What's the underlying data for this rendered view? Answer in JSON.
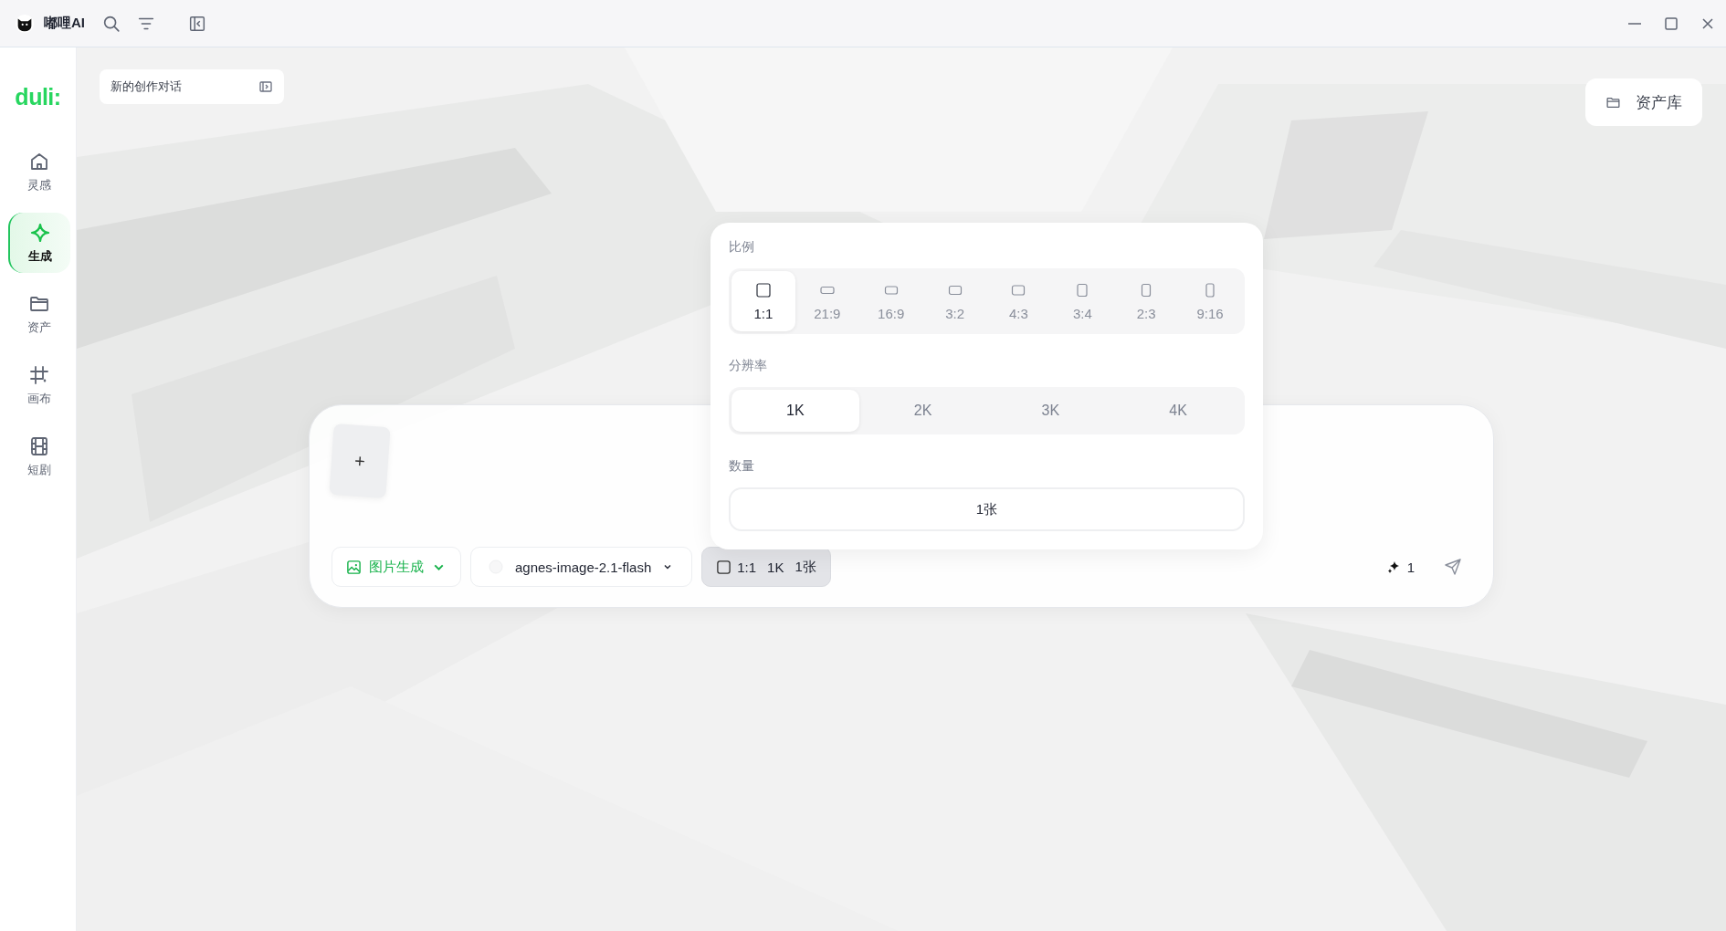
{
  "app": {
    "title": "嘟哩AI"
  },
  "sidebar": {
    "logo": "duli:",
    "items": [
      {
        "label": "灵感",
        "kind": "home",
        "selected": false
      },
      {
        "label": "生成",
        "kind": "sparkle",
        "selected": true
      },
      {
        "label": "资产",
        "kind": "folder",
        "selected": false
      },
      {
        "label": "画布",
        "kind": "crop",
        "selected": false
      },
      {
        "label": "短剧",
        "kind": "film",
        "selected": false
      }
    ]
  },
  "session": {
    "title": "新的创作对话"
  },
  "asset_library": {
    "label": "资产库"
  },
  "settings_popup": {
    "ratio": {
      "label": "比例",
      "options": [
        {
          "label": "1:1",
          "selected": true
        },
        {
          "label": "21:9",
          "selected": false
        },
        {
          "label": "16:9",
          "selected": false
        },
        {
          "label": "3:2",
          "selected": false
        },
        {
          "label": "4:3",
          "selected": false
        },
        {
          "label": "3:4",
          "selected": false
        },
        {
          "label": "2:3",
          "selected": false
        },
        {
          "label": "9:16",
          "selected": false
        }
      ]
    },
    "resolution": {
      "label": "分辨率",
      "options": [
        {
          "label": "1K",
          "selected": true
        },
        {
          "label": "2K",
          "selected": false
        },
        {
          "label": "3K",
          "selected": false
        },
        {
          "label": "4K",
          "selected": false
        }
      ]
    },
    "quantity": {
      "label": "数量",
      "value": "1张"
    }
  },
  "composer": {
    "add": "+",
    "mode": {
      "label": "图片生成"
    },
    "model": {
      "label": "agnes-image-2.1-flash"
    },
    "settings_summary": {
      "active": true,
      "values": [
        "1:1",
        "1K",
        "1张"
      ]
    },
    "credits": "1"
  }
}
